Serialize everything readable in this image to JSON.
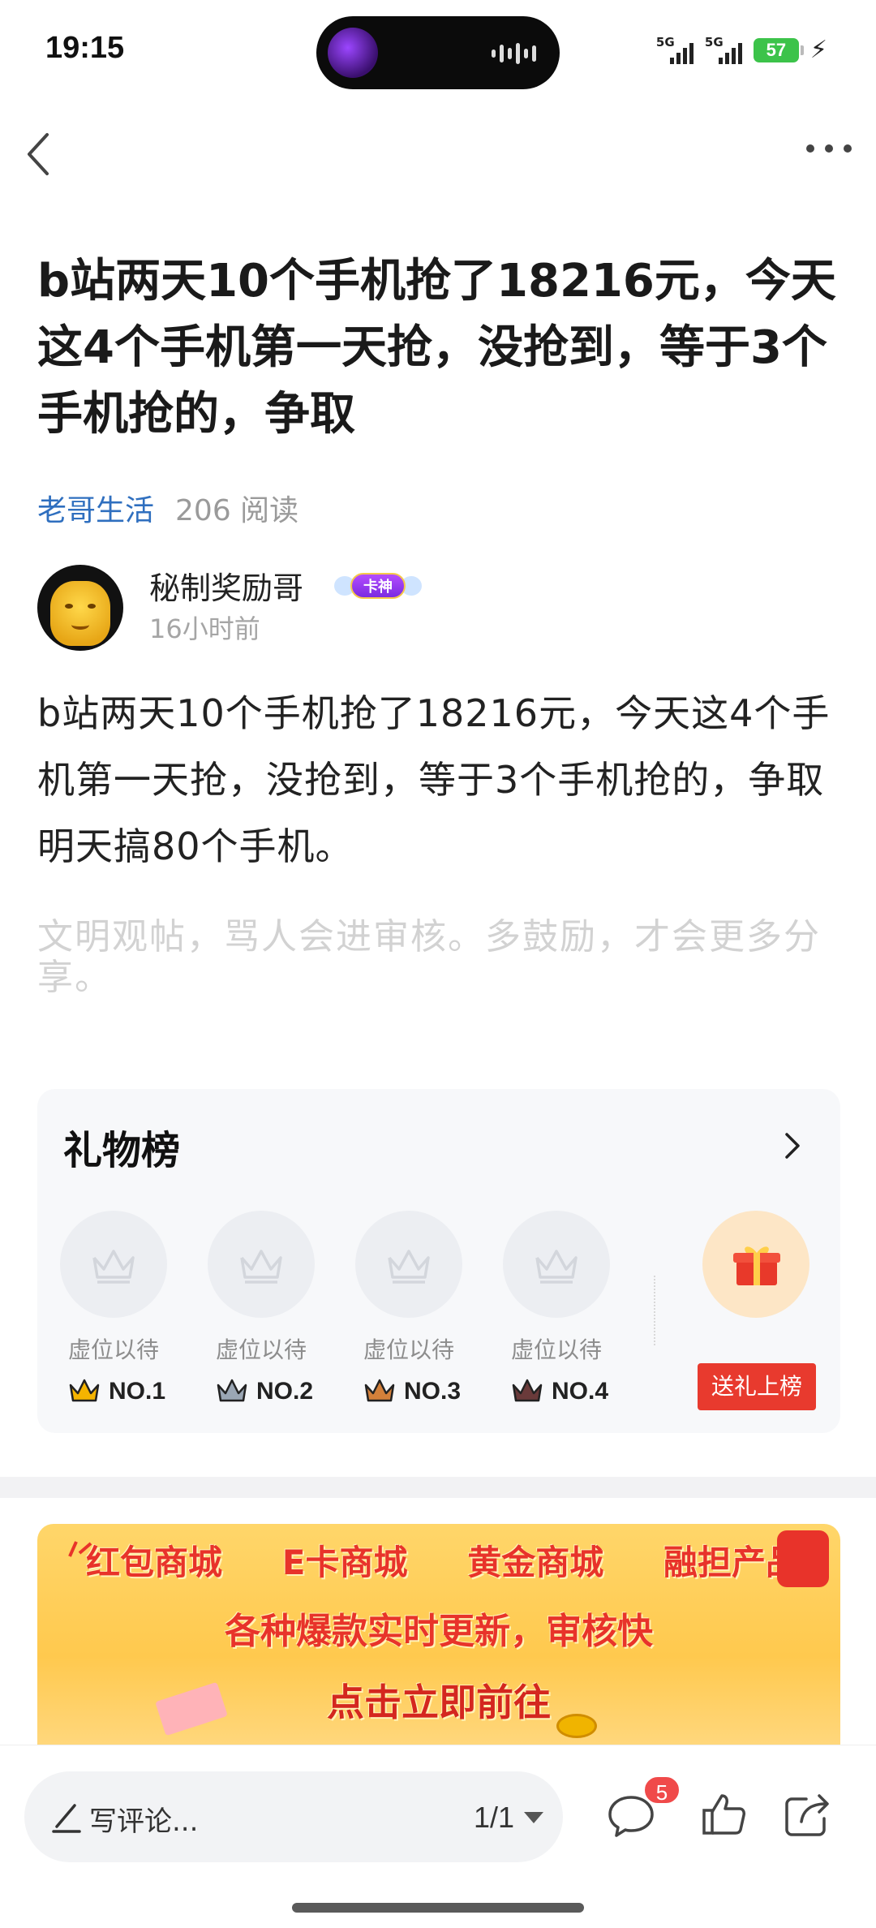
{
  "status_bar": {
    "time": "19:15",
    "signal1_label": "5G",
    "signal2_label": "5G",
    "battery": "57"
  },
  "article": {
    "title": "b站两天10个手机抢了18216元，今天这4个手机第一天抢，没抢到，等于3个手机抢的，争取",
    "channel": "老哥生活",
    "reads": "206 阅读",
    "author": "秘制奖励哥",
    "author_badge": "卡神",
    "post_time": "16小时前",
    "body": "b站两天10个手机抢了18216元，今天这4个手机第一天抢，没抢到，等于3个手机抢的，争取明天搞80个手机。",
    "notice": "文明观帖，骂人会进审核。多鼓励，才会更多分享。"
  },
  "gift_board": {
    "title": "礼物榜",
    "slots": [
      {
        "label": "虚位以待",
        "rank": "NO.1"
      },
      {
        "label": "虚位以待",
        "rank": "NO.2"
      },
      {
        "label": "虚位以待",
        "rank": "NO.3"
      },
      {
        "label": "虚位以待",
        "rank": "NO.4"
      }
    ],
    "send_button": "送礼上榜"
  },
  "banner": {
    "row1": [
      "红包商城",
      "E卡商城",
      "黄金商城",
      "融担产品"
    ],
    "row2": "各种爆款实时更新，审核快",
    "row3": "点击立即前往"
  },
  "bottom_bar": {
    "comment_placeholder": "写评论...",
    "pager": "1/1",
    "comment_count": "5"
  },
  "colors": {
    "channel": "#2f6fbf",
    "send_button": "#e83a2e",
    "badge": "#f04a4a",
    "crown_gold": "#f5b400",
    "crown_silver": "#9aa6b4",
    "crown_bronze": "#d3803a",
    "crown_dark": "#6a3a3a"
  }
}
